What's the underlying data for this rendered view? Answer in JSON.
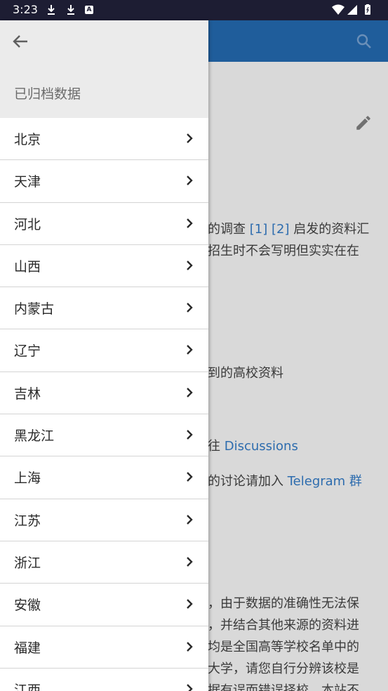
{
  "status_bar": {
    "time": "3:23"
  },
  "drawer": {
    "title": "已归档数据",
    "items": [
      {
        "label": "北京"
      },
      {
        "label": "天津"
      },
      {
        "label": "河北"
      },
      {
        "label": "山西"
      },
      {
        "label": "内蒙古"
      },
      {
        "label": "辽宁"
      },
      {
        "label": "吉林"
      },
      {
        "label": "黑龙江"
      },
      {
        "label": "上海"
      },
      {
        "label": "江苏"
      },
      {
        "label": "浙江"
      },
      {
        "label": "安徽"
      },
      {
        "label": "福建"
      },
      {
        "label": "江西"
      }
    ]
  },
  "page": {
    "lines": [
      {
        "pre": "的调查 ",
        "link1": "[1]",
        "mid": " ",
        "link2": "[2]",
        "post": " 启发的资料汇"
      },
      {
        "text": "招生时不会写明但实实在在"
      },
      {
        "text": "到的高校资料"
      },
      {
        "pre": "往 ",
        "link": "Discussions"
      },
      {
        "pre": "的讨论请加入 ",
        "link": "Telegram 群"
      },
      {
        "text": "，由于数据的准确性无法保"
      },
      {
        "text": "，并结合其他来源的资料进"
      },
      {
        "text": "均是全国高等学校名单中的"
      },
      {
        "text": "大学，请您自行分辨该校是"
      },
      {
        "text": "据有误而错误择校，本站不"
      }
    ]
  },
  "colors": {
    "status_bar": "#1d1d33",
    "app_bar": "#1f5d9b",
    "link": "#2d6cae",
    "drawer_header": "#ebebeb"
  },
  "icons": [
    "download-icon",
    "download-icon",
    "a-notification-icon",
    "wifi-icon",
    "signal-icon",
    "battery-icon",
    "search-icon",
    "edit-icon",
    "back-arrow-icon",
    "chevron-right-icon"
  ]
}
